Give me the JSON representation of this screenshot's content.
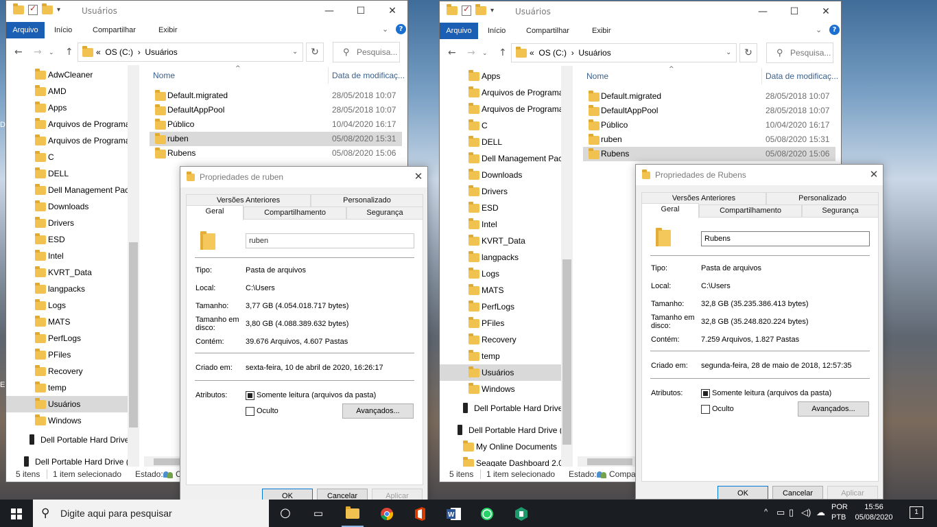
{
  "left_window": {
    "title": "Usuários",
    "ribbon": {
      "file": "Arquivo",
      "home": "Início",
      "share": "Compartilhar",
      "view": "Exibir"
    },
    "path": {
      "prefix": "«",
      "drive": "OS (C:)",
      "sep": "›",
      "folder": "Usuários"
    },
    "search_placeholder": "Pesquisa...",
    "columns": {
      "name": "Nome",
      "date": "Data de modificaç..."
    },
    "nav_items": [
      "AdwCleaner",
      "AMD",
      "Apps",
      "Arquivos de Programa",
      "Arquivos de Programa",
      "C",
      "DELL",
      "Dell Management Pac",
      "Downloads",
      "Drivers",
      "ESD",
      "Intel",
      "KVRT_Data",
      "langpacks",
      "Logs",
      "MATS",
      "PerfLogs",
      "PFiles",
      "Recovery",
      "temp",
      "Usuários",
      "Windows"
    ],
    "nav_drives": [
      "Dell Portable Hard Drive",
      "Dell Portable Hard Drive ("
    ],
    "files": [
      {
        "name": "Default.migrated",
        "date": "28/05/2018 10:07"
      },
      {
        "name": "DefaultAppPool",
        "date": "28/05/2018 10:07"
      },
      {
        "name": "Público",
        "date": "10/04/2020 16:17"
      },
      {
        "name": "ruben",
        "date": "05/08/2020 15:31"
      },
      {
        "name": "Rubens",
        "date": "05/08/2020 15:06"
      }
    ],
    "status": {
      "items": "5 itens",
      "selected": "1 item selecionado",
      "state": "Estado:",
      "state_value": "C"
    }
  },
  "right_window": {
    "title": "Usuários",
    "ribbon": {
      "file": "Arquivo",
      "home": "Início",
      "share": "Compartilhar",
      "view": "Exibir"
    },
    "path": {
      "prefix": "«",
      "drive": "OS (C:)",
      "sep": "›",
      "folder": "Usuários"
    },
    "search_placeholder": "Pesquisa...",
    "columns": {
      "name": "Nome",
      "date": "Data de modificaç..."
    },
    "nav_items": [
      "Apps",
      "Arquivos de Programa",
      "Arquivos de Programa",
      "C",
      "DELL",
      "Dell Management Pac",
      "Downloads",
      "Drivers",
      "ESD",
      "Intel",
      "KVRT_Data",
      "langpacks",
      "Logs",
      "MATS",
      "PerfLogs",
      "PFiles",
      "Recovery",
      "temp",
      "Usuários",
      "Windows"
    ],
    "nav_drives": [
      "Dell Portable Hard Drive",
      "Dell Portable Hard Drive ("
    ],
    "nav_extra": [
      "My Online Documents",
      "Seagate Dashboard 2.0"
    ],
    "files": [
      {
        "name": "Default.migrated",
        "date": "28/05/2018 10:07"
      },
      {
        "name": "DefaultAppPool",
        "date": "28/05/2018 10:07"
      },
      {
        "name": "Público",
        "date": "10/04/2020 16:17"
      },
      {
        "name": "ruben",
        "date": "05/08/2020 15:31"
      },
      {
        "name": "Rubens",
        "date": "05/08/2020 15:06"
      }
    ],
    "status": {
      "items": "5 itens",
      "selected": "1 item selecionado",
      "state": "Estado:",
      "state_value": "Compa"
    }
  },
  "dialog_ruben": {
    "title": "Propriedades de ruben",
    "tabs_top": [
      "Versões Anteriores",
      "Personalizado"
    ],
    "tabs_bottom": [
      "Geral",
      "Compartilhamento",
      "Segurança"
    ],
    "name": "ruben",
    "type_label": "Tipo:",
    "type": "Pasta de arquivos",
    "location_label": "Local:",
    "location": "C:\\Users",
    "size_label": "Tamanho:",
    "size": "3,77 GB (4.054.018.717 bytes)",
    "disk_label_1": "Tamanho em",
    "disk_label_2": "disco:",
    "disk": "3,80 GB (4.088.389.632 bytes)",
    "contains_label": "Contém:",
    "contains": "39.676 Arquivos, 4.607 Pastas",
    "created_label": "Criado em:",
    "created": "sexta-feira, 10 de abril de 2020, 16:26:17",
    "attributes_label": "Atributos:",
    "readonly": "Somente leitura (arquivos da pasta)",
    "hidden": "Oculto",
    "advanced": "Avançados...",
    "ok": "OK",
    "cancel": "Cancelar",
    "apply": "Aplicar"
  },
  "dialog_rubens": {
    "title": "Propriedades de Rubens",
    "tabs_top": [
      "Versões Anteriores",
      "Personalizado"
    ],
    "tabs_bottom": [
      "Geral",
      "Compartilhamento",
      "Segurança"
    ],
    "name": "Rubens",
    "type_label": "Tipo:",
    "type": "Pasta de arquivos",
    "location_label": "Local:",
    "location": "C:\\Users",
    "size_label": "Tamanho:",
    "size": "32,8 GB (35.235.386.413 bytes)",
    "disk_label_1": "Tamanho em",
    "disk_label_2": "disco:",
    "disk": "32,8 GB (35.248.820.224 bytes)",
    "contains_label": "Contém:",
    "contains": "7.259 Arquivos, 1.827 Pastas",
    "created_label": "Criado em:",
    "created": "segunda-feira, 28 de maio de 2018, 12:57:35",
    "attributes_label": "Atributos:",
    "readonly": "Somente leitura (arquivos da pasta)",
    "hidden": "Oculto",
    "advanced": "Avançados...",
    "ok": "OK",
    "cancel": "Cancelar",
    "apply": "Aplicar"
  },
  "taskbar": {
    "search_placeholder": "Digite aqui para pesquisar",
    "lang_1": "POR",
    "lang_2": "PTB",
    "time": "15:56",
    "date": "05/08/2020",
    "notifications": "1"
  },
  "desktop_edge_text": [
    "Del",
    "E"
  ],
  "colors": {
    "accent": "#1a5fb4",
    "selection": "#d9d9d9",
    "folder": "#f2c250"
  }
}
